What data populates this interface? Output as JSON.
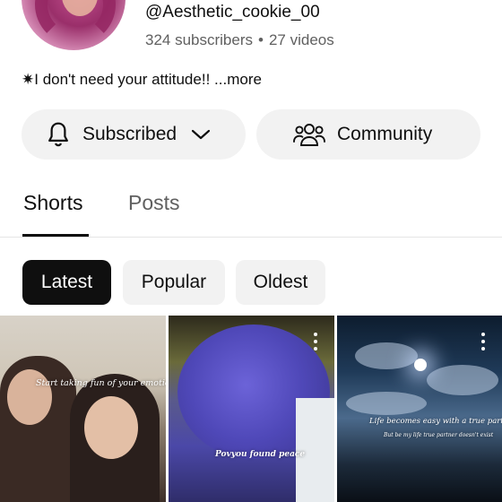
{
  "channel": {
    "handle": "@Aesthetic_cookie_00",
    "subscribers": "324 subscribers",
    "separator": "•",
    "videos": "27 videos",
    "description": "✷I don't need your attitude!!",
    "more_label": "...more"
  },
  "actions": {
    "subscribed_label": "Subscribed",
    "community_label": "Community"
  },
  "tabs": [
    {
      "label": "Shorts",
      "selected": true
    },
    {
      "label": "Posts",
      "selected": false
    }
  ],
  "filters": [
    {
      "label": "Latest",
      "selected": true
    },
    {
      "label": "Popular",
      "selected": false
    },
    {
      "label": "Oldest",
      "selected": false
    }
  ],
  "shorts": [
    {
      "caption": "Start taking fun of your emotions"
    },
    {
      "caption": "Povyou found peace"
    },
    {
      "caption": "Life becomes easy with a true partner",
      "subcaption": "But be my life true partner doesn't exist"
    }
  ],
  "icons": {
    "bell": "bell-icon",
    "chevron": "chevron-down-icon",
    "community": "people-icon",
    "more": "more-vert-icon"
  },
  "colors": {
    "chip_selected_bg": "#0f0f0f",
    "chip_bg": "#f2f2f2",
    "secondary_text": "#606060"
  }
}
